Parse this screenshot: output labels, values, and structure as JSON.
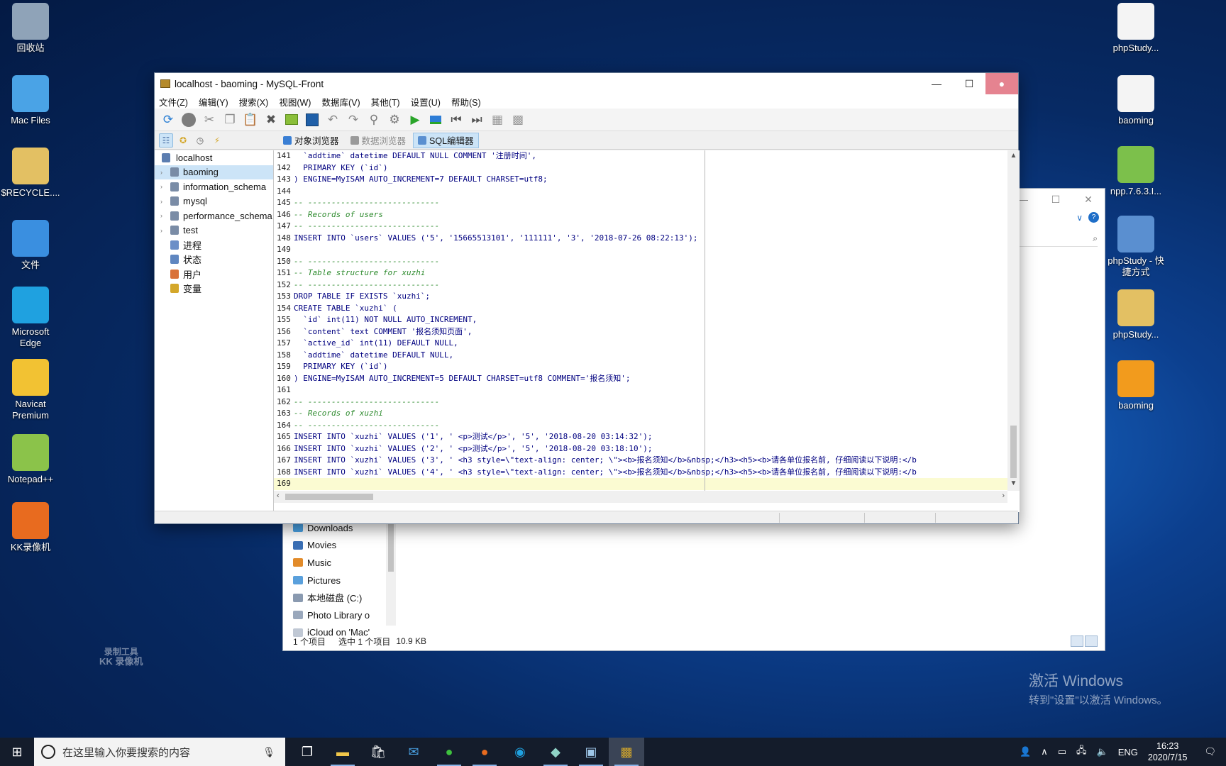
{
  "desktop": {
    "left_icons": [
      {
        "label": "回收站",
        "icon": "recycle-bin-icon",
        "color": "#8fa3b8"
      },
      {
        "label": "Mac Files",
        "icon": "folder-icon",
        "color": "#4aa3e6"
      },
      {
        "label": "$RECYCLE....",
        "icon": "folder-icon",
        "color": "#e3c063"
      },
      {
        "label": "文件",
        "icon": "file-icon",
        "color": "#3a8fe0"
      },
      {
        "label": "Microsoft Edge",
        "icon": "edge-icon",
        "color": "#1fa1e0"
      },
      {
        "label": "Navicat Premium",
        "icon": "navicat-icon",
        "color": "#f2c233"
      },
      {
        "label": "Notepad++",
        "icon": "notepad-icon",
        "color": "#8bc34a"
      },
      {
        "label": "KK录像机",
        "icon": "kk-recorder-icon",
        "color": "#e86b1f"
      }
    ],
    "right_icons": [
      {
        "label": "phpStudy...",
        "icon": "document-icon",
        "color": "#f4f4f4"
      },
      {
        "label": "baoming",
        "icon": "document-icon",
        "color": "#f4f4f4"
      },
      {
        "label": "npp.7.6.3.I...",
        "icon": "installer-icon",
        "color": "#7cc04b"
      },
      {
        "label": "phpStudy - 快捷方式",
        "icon": "phpstudy-icon",
        "color": "#5a8fd0"
      },
      {
        "label": "phpStudy...",
        "icon": "folder-icon",
        "color": "#e3c063"
      },
      {
        "label": "baoming",
        "icon": "sublime-icon",
        "color": "#f29b1d"
      }
    ],
    "watermark_line1": "激活 Windows",
    "watermark_line2": "转到\"设置\"以激活 Windows。",
    "kk_watermark_line1": "录制工具",
    "kk_watermark_line2": "KK 录像机"
  },
  "explorer": {
    "nav_items": [
      "Downloads",
      "Movies",
      "Music",
      "Pictures",
      "本地磁盘 (C:)",
      "Photo Library o",
      "iCloud on 'Mac'"
    ],
    "status_items": "1 个项目",
    "status_selected": "选中 1 个项目",
    "status_size": "10.9 KB"
  },
  "window": {
    "title": "localhost - baoming - MySQL-Front",
    "menu": [
      "文件(Z)",
      "编辑(Y)",
      "搜索(X)",
      "视图(W)",
      "数据库(V)",
      "其他(T)",
      "设置(U)",
      "帮助(S)"
    ],
    "tabs": [
      {
        "label": "对象浏览器",
        "state": "normal"
      },
      {
        "label": "数据浏览器",
        "state": "disabled"
      },
      {
        "label": "SQL编辑器",
        "state": "active"
      }
    ],
    "tree": [
      {
        "label": "localhost",
        "root": true,
        "color": "#5b7db0"
      },
      {
        "label": "baoming",
        "selected": true,
        "color": "#7a8ca6"
      },
      {
        "label": "information_schema",
        "color": "#7a8ca6"
      },
      {
        "label": "mysql",
        "color": "#7a8ca6"
      },
      {
        "label": "performance_schema",
        "color": "#7a8ca6"
      },
      {
        "label": "test",
        "color": "#7a8ca6"
      },
      {
        "label": "进程",
        "color": "#6c8fc7"
      },
      {
        "label": "状态",
        "color": "#5f86c0"
      },
      {
        "label": "用户",
        "color": "#d9723a"
      },
      {
        "label": "变量",
        "color": "#d4a72a"
      }
    ],
    "code": [
      {
        "n": "141",
        "t": "  `addtime` datetime DEFAULT NULL COMMENT '注册时间',"
      },
      {
        "n": "142",
        "t": "  PRIMARY KEY (`id`)"
      },
      {
        "n": "143",
        "t": ") ENGINE=MyISAM AUTO_INCREMENT=7 DEFAULT CHARSET=utf8;"
      },
      {
        "n": "144",
        "t": ""
      },
      {
        "n": "145",
        "t": "-- ----------------------------",
        "c": true
      },
      {
        "n": "146",
        "t": "-- Records of users",
        "c": true
      },
      {
        "n": "147",
        "t": "-- ----------------------------",
        "c": true
      },
      {
        "n": "148",
        "t": "INSERT INTO `users` VALUES ('5', '15665513101', '111111', '3', '2018-07-26 08:22:13');"
      },
      {
        "n": "149",
        "t": ""
      },
      {
        "n": "150",
        "t": "-- ----------------------------",
        "c": true
      },
      {
        "n": "151",
        "t": "-- Table structure for xuzhi",
        "c": true
      },
      {
        "n": "152",
        "t": "-- ----------------------------",
        "c": true
      },
      {
        "n": "153",
        "t": "DROP TABLE IF EXISTS `xuzhi`;"
      },
      {
        "n": "154",
        "t": "CREATE TABLE `xuzhi` ("
      },
      {
        "n": "155",
        "t": "  `id` int(11) NOT NULL AUTO_INCREMENT,"
      },
      {
        "n": "156",
        "t": "  `content` text COMMENT '报名须知页面',"
      },
      {
        "n": "157",
        "t": "  `active_id` int(11) DEFAULT NULL,"
      },
      {
        "n": "158",
        "t": "  `addtime` datetime DEFAULT NULL,"
      },
      {
        "n": "159",
        "t": "  PRIMARY KEY (`id`)"
      },
      {
        "n": "160",
        "t": ") ENGINE=MyISAM AUTO_INCREMENT=5 DEFAULT CHARSET=utf8 COMMENT='报名须知';"
      },
      {
        "n": "161",
        "t": ""
      },
      {
        "n": "162",
        "t": "-- ----------------------------",
        "c": true
      },
      {
        "n": "163",
        "t": "-- Records of xuzhi",
        "c": true
      },
      {
        "n": "164",
        "t": "-- ----------------------------",
        "c": true
      },
      {
        "n": "165",
        "t": "INSERT INTO `xuzhi` VALUES ('1', ' <p>测试</p>', '5', '2018-08-20 03:14:32');"
      },
      {
        "n": "166",
        "t": "INSERT INTO `xuzhi` VALUES ('2', ' <p>测试</p>', '5', '2018-08-20 03:18:10');"
      },
      {
        "n": "167",
        "t": "INSERT INTO `xuzhi` VALUES ('3', ' <h3 style=\\\"text-align: center; \\\"><b>报名须知</b>&nbsp;</h3><h5><b>请各单位报名前, 仔细阅读以下说明:</b"
      },
      {
        "n": "168",
        "t": "INSERT INTO `xuzhi` VALUES ('4', ' <h3 style=\\\"text-align: center; \\\"><b>报名须知</b>&nbsp;</h3><h5><b>请各单位报名前, 仔细阅读以下说明:</b"
      },
      {
        "n": "169",
        "t": "",
        "current": true
      }
    ]
  },
  "taskbar": {
    "search_placeholder": "在这里输入你要搜索的内容",
    "time": "16:23",
    "date": "2020/7/15",
    "lang": "ENG"
  }
}
